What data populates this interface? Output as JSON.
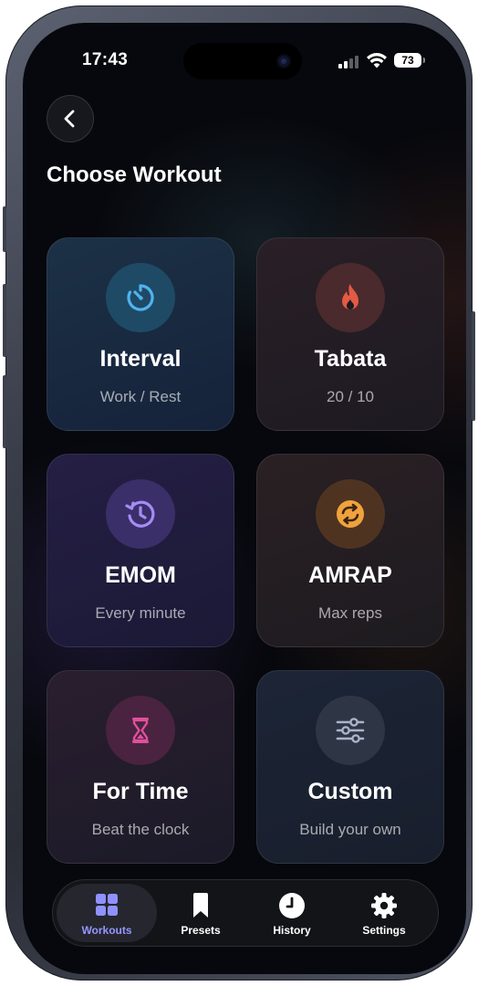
{
  "status_bar": {
    "time": "17:43",
    "battery": "73"
  },
  "header": {
    "title": "Choose Workout"
  },
  "colors": {
    "accent": "#8f91ff",
    "interval": "#4fb3f0",
    "tabata": "#e35a45",
    "emom": "#a48cf6",
    "amrap": "#f0a23d",
    "fortime": "#e0509c",
    "custom": "#aab4c8"
  },
  "workouts": [
    {
      "title": "Interval",
      "subtitle": "Work / Rest",
      "icon": "timer-icon"
    },
    {
      "title": "Tabata",
      "subtitle": "20 / 10",
      "icon": "flame-icon"
    },
    {
      "title": "EMOM",
      "subtitle": "Every minute",
      "icon": "history-clock-icon"
    },
    {
      "title": "AMRAP",
      "subtitle": "Max reps",
      "icon": "repeat-icon"
    },
    {
      "title": "For Time",
      "subtitle": "Beat the clock",
      "icon": "hourglass-icon"
    },
    {
      "title": "Custom",
      "subtitle": "Build your own",
      "icon": "sliders-icon"
    }
  ],
  "tabs": [
    {
      "label": "Workouts",
      "icon": "grid-icon",
      "active": true
    },
    {
      "label": "Presets",
      "icon": "bookmark-icon",
      "active": false
    },
    {
      "label": "History",
      "icon": "clock-icon",
      "active": false
    },
    {
      "label": "Settings",
      "icon": "gear-icon",
      "active": false
    }
  ]
}
